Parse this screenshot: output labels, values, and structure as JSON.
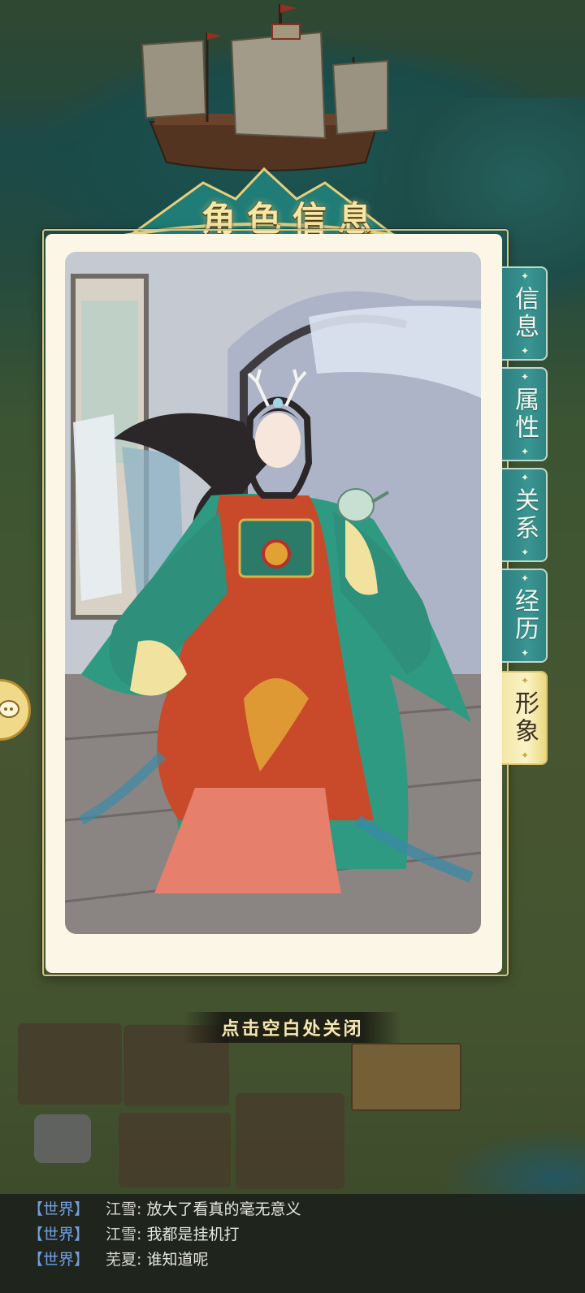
{
  "header": {
    "title": "角色信息"
  },
  "tabs": [
    {
      "label": "信息",
      "active": false
    },
    {
      "label": "属性",
      "active": false
    },
    {
      "label": "关系",
      "active": false
    },
    {
      "label": "经历",
      "active": false
    },
    {
      "label": "形象",
      "active": true
    }
  ],
  "portrait": {
    "character": "court-lady-figure"
  },
  "close_hint": "点击空白处关闭",
  "chat": {
    "lines": [
      {
        "channel": "【世界】",
        "sender": "江雪",
        "message": "放大了看真的毫无意义"
      },
      {
        "channel": "【世界】",
        "sender": "江雪",
        "message": "我都是挂机打"
      },
      {
        "channel": "【世界】",
        "sender": "芜夏",
        "message": "谁知道呢"
      }
    ]
  },
  "colors": {
    "tab_teal": "#2d7f80",
    "tab_active_gold": "#f3e6a6",
    "title_gold": "#f6e7a6",
    "chat_channel_blue": "#6fa0e4",
    "card_cream": "#fbf6e6"
  }
}
